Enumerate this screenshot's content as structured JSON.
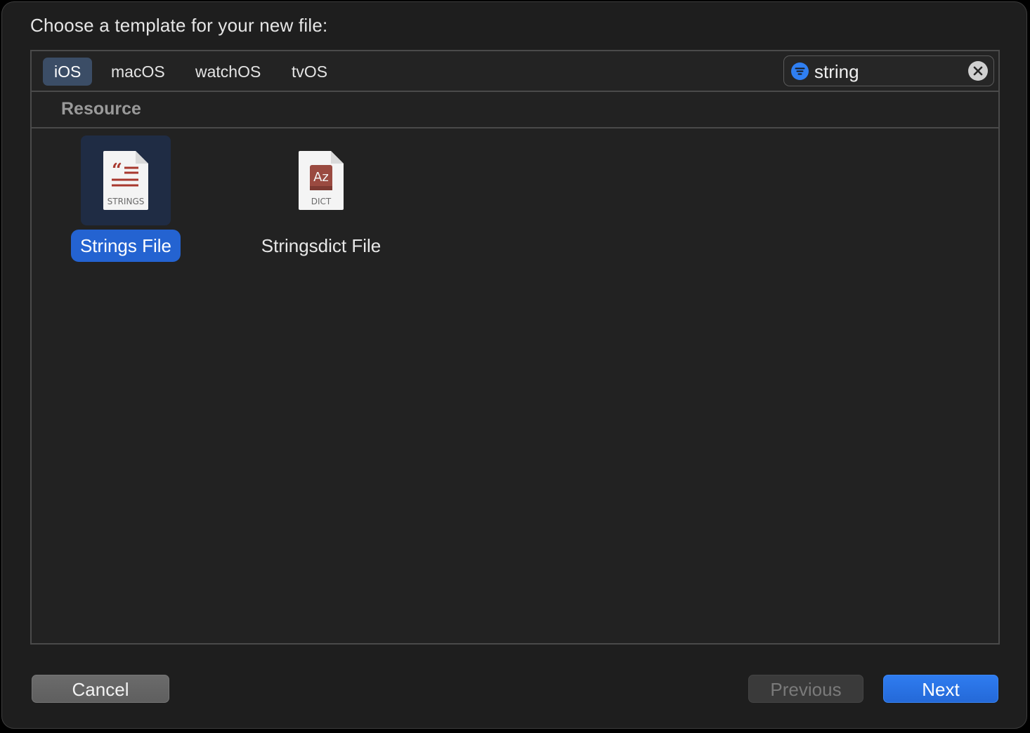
{
  "dialog": {
    "prompt": "Choose a template for your new file:"
  },
  "platform_tabs": [
    {
      "label": "iOS",
      "active": true
    },
    {
      "label": "macOS",
      "active": false
    },
    {
      "label": "watchOS",
      "active": false
    },
    {
      "label": "tvOS",
      "active": false
    }
  ],
  "search": {
    "value": "string",
    "filter_icon": "filter-icon",
    "clear_icon": "clear-circle-x-icon"
  },
  "section": {
    "title": "Resource"
  },
  "templates": [
    {
      "name": "Strings File",
      "badge": "STRINGS",
      "icon": "strings-file-icon",
      "selected": true
    },
    {
      "name": "Stringsdict File",
      "badge": "DICT",
      "glyph": "Az",
      "icon": "stringsdict-file-icon",
      "selected": false
    }
  ],
  "buttons": {
    "cancel": "Cancel",
    "previous": "Previous",
    "next": "Next",
    "previous_enabled": false
  },
  "colors": {
    "accent": "#2463d1",
    "active_tab": "#3b4d66",
    "icon_red": "#a8382e",
    "background": "#1e1e1e"
  }
}
